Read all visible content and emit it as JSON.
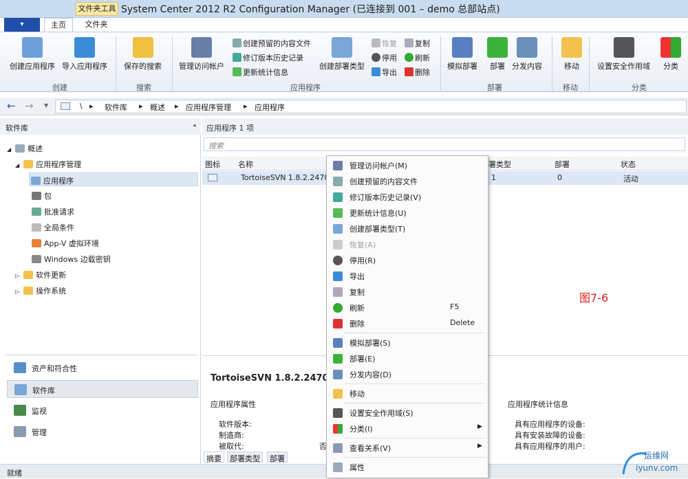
{
  "window": {
    "title": "System Center 2012 R2 Configuration Manager (已连接到 001 – demo 总部站点)",
    "context_tab": "文件夹工具",
    "app_button": "▾"
  },
  "ribbon_tabs": [
    "主页",
    "文件夹"
  ],
  "ribbon": {
    "create_app": "创建应用程序",
    "import_app": "导入应用程序",
    "saved_search": "保存的搜索",
    "manage_access": "管理访问帐户",
    "create_prestaged": "创建预留的内容文件",
    "revision_history": "修订版本历史记录",
    "update_stats": "更新统计信息",
    "create_deploy_type": "创建部署类型",
    "restore": "恢复",
    "retire": "停用",
    "export": "导出",
    "copy": "复制",
    "refresh": "刷新",
    "delete": "删除",
    "simulate_deploy": "模拟部署",
    "deploy": "部署",
    "distribute": "分发内容",
    "move": "移动",
    "set_security": "设置安全作用域",
    "categorize": "分类",
    "groups": {
      "create": "创建",
      "search": "搜索",
      "application": "应用程序",
      "deployment": "部署",
      "move": "移动",
      "classify": "分类"
    }
  },
  "breadcrumb": [
    "\\",
    "软件库",
    "概述",
    "应用程序管理",
    "应用程序"
  ],
  "nav": {
    "header": "软件库",
    "tree": [
      "概述",
      "应用程序管理",
      "应用程序",
      "包",
      "批准请求",
      "全局条件",
      "App-V 虚拟环境",
      "Windows 边载密钥",
      "软件更新",
      "操作系统"
    ],
    "workspaces": [
      "资产和符合性",
      "软件库",
      "监视",
      "管理"
    ]
  },
  "list": {
    "header": "应用程序 1 项",
    "search_placeholder": "搜索",
    "columns": [
      "图标",
      "名称",
      "署类型",
      "部署",
      "状态"
    ],
    "rows": [
      {
        "name": "TortoiseSVN 1.8.2.2470",
        "deploy_types": "1",
        "deployments": "0",
        "status": "活动"
      }
    ]
  },
  "details": {
    "title": "TortoiseSVN 1.8.2.24708",
    "props_header": "应用程序属性",
    "stats_header": "应用程序统计信息",
    "props": [
      "软件版本:",
      "制造商:",
      "被取代:"
    ],
    "props_value": "否",
    "stats": [
      "具有应用程序的设备:",
      "具有安装故障的设备:",
      "具有应用程序的用户:"
    ],
    "tabs": [
      "摘要",
      "部署类型",
      "部署"
    ]
  },
  "context_menu": [
    {
      "label": "管理访问帐户(M)"
    },
    {
      "label": "创建预留的内容文件"
    },
    {
      "label": "修订版本历史记录(V)"
    },
    {
      "label": "更新统计信息(U)"
    },
    {
      "label": "创建部署类型(T)"
    },
    {
      "label": "恢复(A)"
    },
    {
      "label": "停用(R)"
    },
    {
      "label": "导出"
    },
    {
      "label": "复制"
    },
    {
      "label": "刷新",
      "shortcut": "F5"
    },
    {
      "label": "删除",
      "shortcut": "Delete"
    },
    {
      "label": "模拟部署(S)"
    },
    {
      "label": "部署(E)"
    },
    {
      "label": "分发内容(D)"
    },
    {
      "label": "移动"
    },
    {
      "label": "设置安全作用域(S)"
    },
    {
      "label": "分类(I)"
    },
    {
      "label": "查看关系(V)"
    },
    {
      "label": "属性"
    }
  ],
  "figure_label": "图7-6",
  "status_text": "就绪",
  "watermark": {
    "text": "运维网",
    "url": "iyunv.com"
  }
}
